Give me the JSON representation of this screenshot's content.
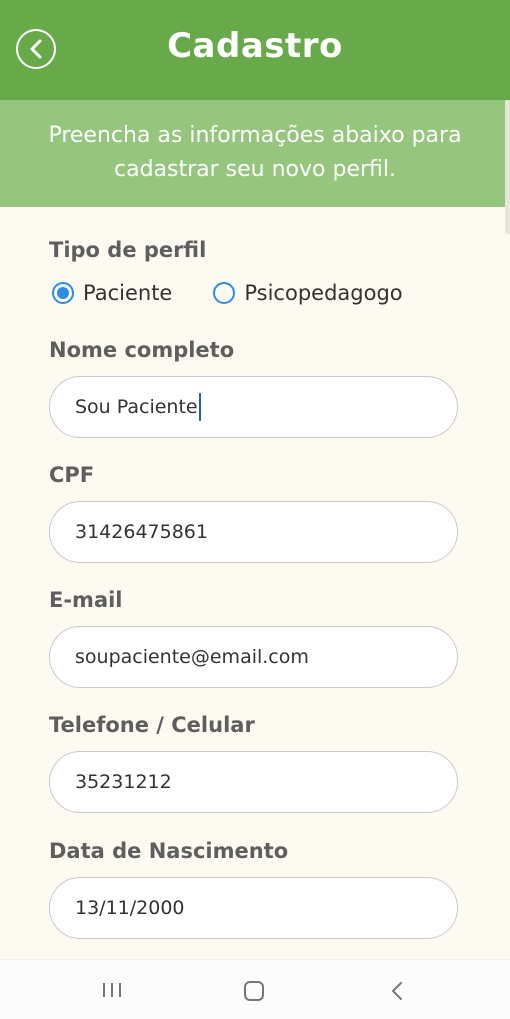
{
  "header": {
    "title": "Cadastro",
    "back_icon": "chevron-left-icon"
  },
  "subheader": {
    "line1": "Preencha as informações abaixo para",
    "line2": "cadastrar seu novo perfil."
  },
  "form": {
    "profile_type": {
      "label": "Tipo de perfil",
      "options": [
        {
          "label": "Paciente",
          "selected": true
        },
        {
          "label": "Psicopedagogo",
          "selected": false
        }
      ]
    },
    "full_name": {
      "label": "Nome completo",
      "value": "Sou Paciente"
    },
    "cpf": {
      "label": "CPF",
      "value": "31426475861"
    },
    "email": {
      "label": "E-mail",
      "value": "soupaciente@email.com"
    },
    "phone": {
      "label": "Telefone / Celular",
      "value": "35231212"
    },
    "birth_date": {
      "label": "Data de Nascimento",
      "value": "13/11/2000"
    }
  },
  "colors": {
    "header_bg": "#68a94a",
    "subheader_bg": "#96c67e",
    "page_bg": "#fdfaf1",
    "radio_accent": "#2c8de3"
  },
  "navbar": {
    "icons": [
      "recent-apps-icon",
      "home-icon",
      "back-icon"
    ]
  }
}
